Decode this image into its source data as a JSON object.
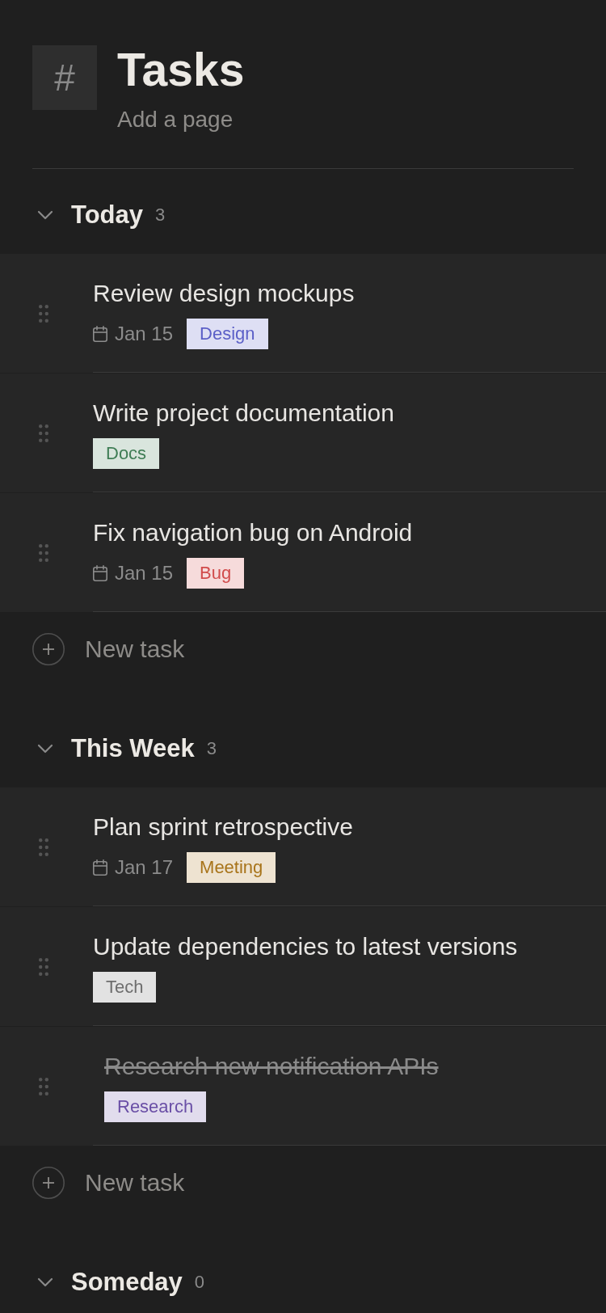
{
  "page": {
    "icon": "#",
    "title": "Tasks",
    "subtitle": "Add a page"
  },
  "sections": [
    {
      "title": "Today",
      "count": "3",
      "expanded": true,
      "tasks": [
        {
          "title": "Review design mockups",
          "completed": false,
          "due": "Jan 15",
          "tag": {
            "label": "Design",
            "color": "#5b5fc7"
          }
        },
        {
          "title": "Write project documentation",
          "completed": false,
          "tag": {
            "label": "Docs",
            "color": "#3f7d55"
          }
        },
        {
          "title": "Fix navigation bug on Android",
          "completed": false,
          "due": "Jan 15",
          "tag": {
            "label": "Bug",
            "color": "#d14b4b"
          }
        }
      ],
      "new_task": "New task"
    },
    {
      "title": "This Week",
      "count": "3",
      "expanded": true,
      "tasks": [
        {
          "title": "Plan sprint retrospective",
          "completed": false,
          "due": "Jan 17",
          "tag": {
            "label": "Meeting",
            "color": "#a8741a"
          }
        },
        {
          "title": "Update dependencies to latest versions",
          "completed": false,
          "tag": {
            "label": "Tech",
            "color": "#6e6e6e"
          }
        },
        {
          "title": "Research new notification APIs",
          "completed": true,
          "tag": {
            "label": "Research",
            "color": "#6a4fa6"
          }
        }
      ],
      "new_task": "New task"
    },
    {
      "title": "Someday",
      "count": "0",
      "expanded": true
    }
  ]
}
